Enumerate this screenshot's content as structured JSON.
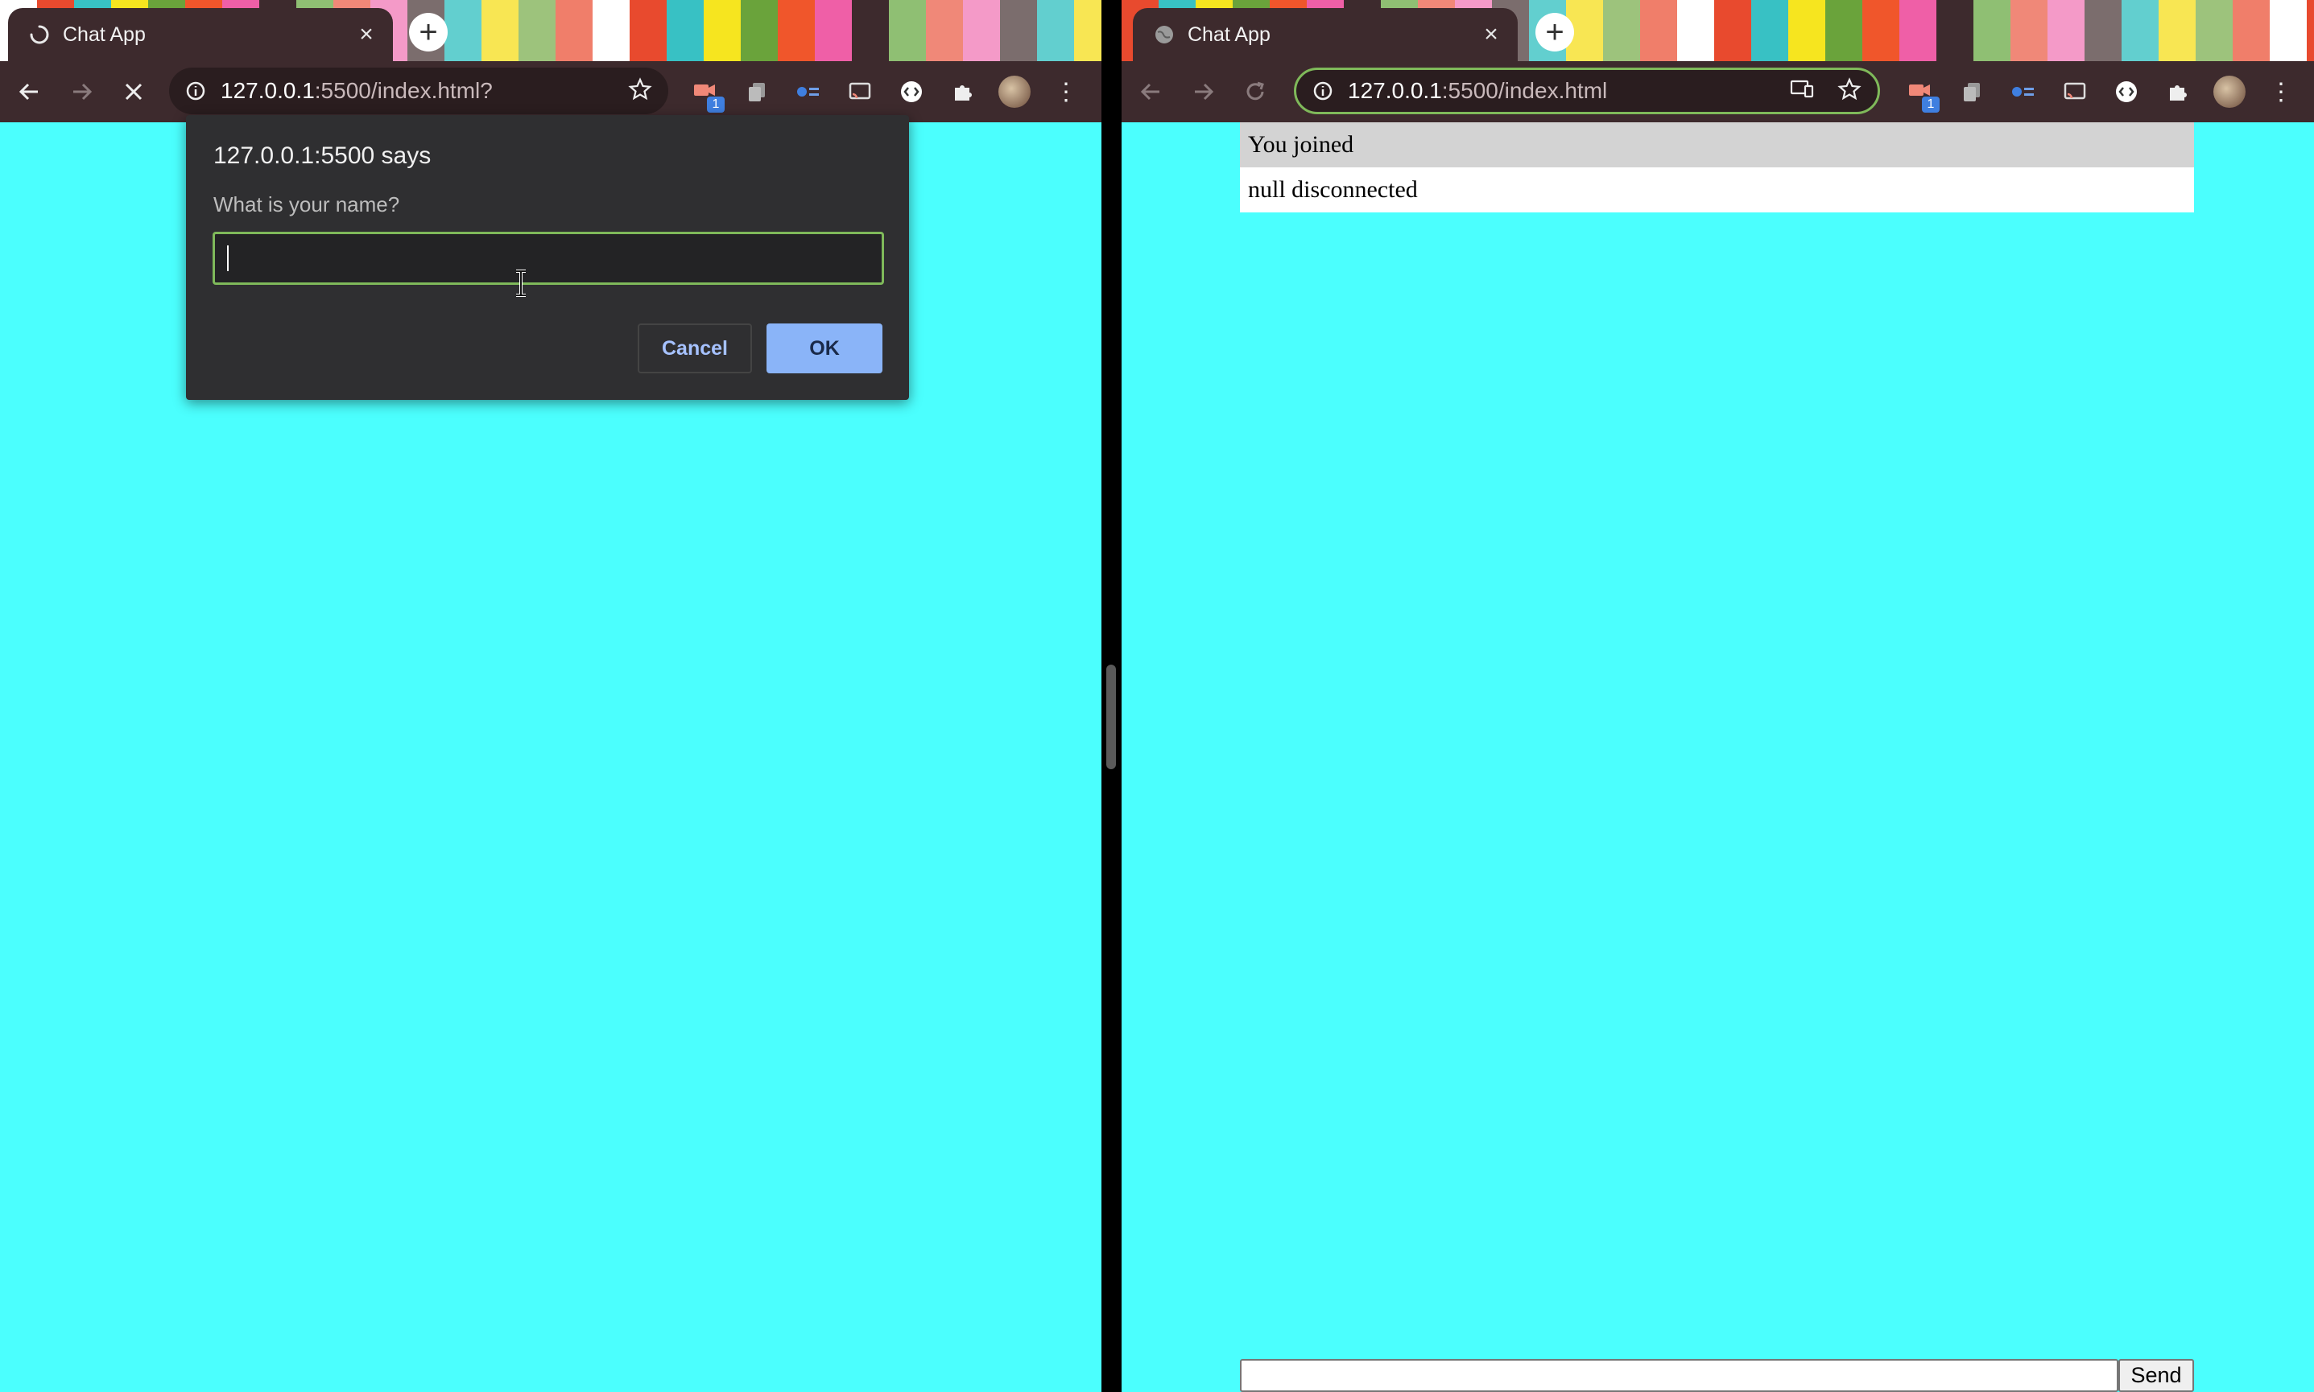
{
  "theme": {
    "stripes": [
      "#ffffff",
      "#e84a2e",
      "#38c1c4",
      "#f6e51f",
      "#6aa33b",
      "#f0562b",
      "#ef5fa7",
      "#3d2a2d",
      "#8fbf73",
      "#f08878",
      "#f49ac8",
      "#7b6d6d",
      "#62cfcf",
      "#f8e653",
      "#9dc37c",
      "#f07e6a"
    ]
  },
  "left_window": {
    "tab": {
      "title": "Chat App"
    },
    "url": {
      "host": "127.0.0.1",
      "path": ":5500/index.html?"
    },
    "extension_badge": "1",
    "dialog": {
      "title": "127.0.0.1:5500 says",
      "message": "What is your name?",
      "input_value": "",
      "cancel_label": "Cancel",
      "ok_label": "OK"
    }
  },
  "right_window": {
    "tab": {
      "title": "Chat App"
    },
    "url": {
      "host": "127.0.0.1",
      "path": ":5500/index.html"
    },
    "extension_badge": "1",
    "messages": [
      "You joined",
      "null disconnected"
    ],
    "chat_input_value": "",
    "send_label": "Send"
  },
  "colors": {
    "page_background": "#4bfffe",
    "chrome_frame": "#3d2a2d",
    "focus_ring": "#7fb95a",
    "ok_button": "#8ab4f8"
  }
}
